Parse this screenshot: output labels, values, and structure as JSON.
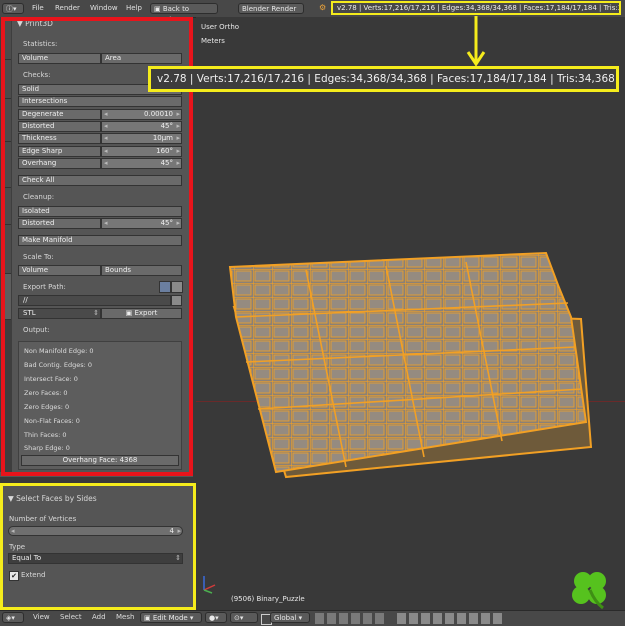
{
  "topbar": {
    "menus": [
      "File",
      "Render",
      "Window",
      "Help"
    ],
    "back_button": "Back to Previous",
    "render_engine": "Blender Render",
    "stats": "v2.78 | Verts:17,216/17,216 | Edges:34,368/34,368 | Faces:17,184/17,184 | Tris:34,368"
  },
  "left_tabs": [
    "Tools",
    "Create",
    "Relations",
    "Shading / UVs",
    "Options",
    "Grease Pencil",
    "3D Printing"
  ],
  "print3d": {
    "header": "Print3D",
    "statistics_label": "Statistics:",
    "volume": "Volume",
    "area": "Area",
    "checks_label": "Checks:",
    "solid": "Solid",
    "intersections": "Intersections",
    "rows": [
      {
        "label": "Degenerate",
        "value": "0.00010"
      },
      {
        "label": "Distorted",
        "value": "45°"
      },
      {
        "label": "Thickness",
        "value": "10µm"
      },
      {
        "label": "Edge Sharp",
        "value": "160°"
      },
      {
        "label": "Overhang",
        "value": "45°"
      }
    ],
    "check_all": "Check All",
    "cleanup_label": "Cleanup:",
    "isolated": "Isolated",
    "distorted2": {
      "label": "Distorted",
      "value": "45°"
    },
    "make_manifold": "Make Manifold",
    "scale_to_label": "Scale To:",
    "scale_volume": "Volume",
    "scale_bounds": "Bounds",
    "export_path_label": "Export Path:",
    "export_path": "//",
    "format": "STL",
    "export": "Export",
    "output_label": "Output:",
    "output_lines": [
      "Non Manifold Edge: 0",
      "Bad Contig. Edges: 0",
      "Intersect Face: 0",
      "Zero Faces: 0",
      "Zero Edges: 0",
      "Non-Flat Faces: 0",
      "Thin Faces: 0",
      "Sharp Edge: 0"
    ],
    "overhang_face": "Overhang Face: 4368"
  },
  "select_faces": {
    "header": "Select Faces by Sides",
    "num_vertices_label": "Number of Vertices",
    "num_vertices": "4",
    "type_label": "Type",
    "type_value": "Equal To",
    "extend": "Extend"
  },
  "viewport": {
    "view_name": "User Ortho",
    "units": "Meters",
    "object_label": "(9506) Binary_Puzzle"
  },
  "bottombar": {
    "menus": [
      "View",
      "Select",
      "Add",
      "Mesh"
    ],
    "mode": "Edit Mode",
    "orientation": "Global"
  },
  "colors": {
    "highlight_red": "#e8141b",
    "highlight_yellow": "#f5ec1c",
    "mesh_orange": "#f2a024",
    "clover_green": "#56c21e"
  }
}
